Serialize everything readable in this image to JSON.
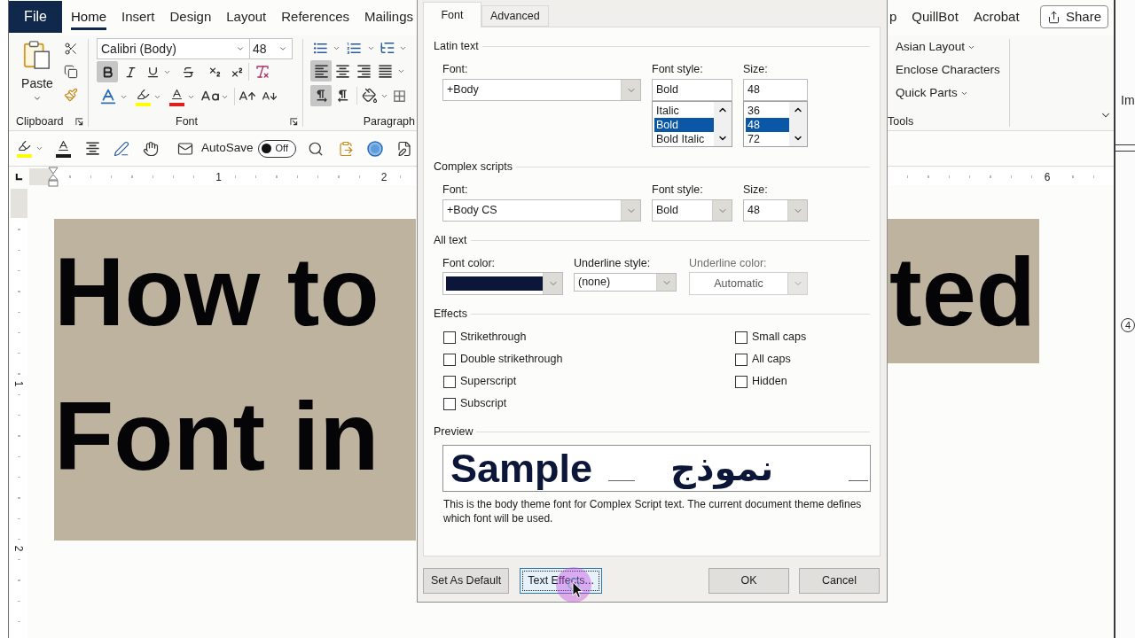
{
  "word": {
    "tabs_left": [
      {
        "label": "File",
        "kind": "file",
        "selected": false
      },
      {
        "label": "Home",
        "kind": "tab",
        "selected": true
      },
      {
        "label": "Insert",
        "kind": "tab",
        "selected": false
      },
      {
        "label": "Design",
        "kind": "tab",
        "selected": false
      },
      {
        "label": "Layout",
        "kind": "tab",
        "selected": false
      },
      {
        "label": "References",
        "kind": "tab",
        "selected": false
      },
      {
        "label": "Mailings",
        "kind": "tab",
        "selected": false
      }
    ],
    "tabs_right": [
      {
        "label": "p",
        "kind": "tab",
        "selected": false
      },
      {
        "label": "QuillBot",
        "kind": "tab",
        "selected": false
      },
      {
        "label": "Acrobat",
        "kind": "tab",
        "selected": false
      }
    ],
    "share_button": "Share",
    "clipboard": {
      "paste_label": "Paste",
      "group_label": "Clipboard"
    },
    "font": {
      "font_name": "Calibri (Body)",
      "font_size": "48",
      "format": [
        {
          "kind": "bold",
          "on": true
        },
        {
          "kind": "italic",
          "on": false
        },
        {
          "kind": "underline",
          "on": false
        },
        {
          "kind": "strikethrough",
          "on": false
        },
        {
          "kind": "subscript",
          "on": false
        },
        {
          "kind": "superscript",
          "on": false
        }
      ],
      "group_label": "Font"
    },
    "paragraph": {
      "align": [
        {
          "kind": "left",
          "on": true
        },
        {
          "kind": "center",
          "on": false
        },
        {
          "kind": "right",
          "on": false
        },
        {
          "kind": "justify",
          "on": false
        }
      ],
      "direction": [
        {
          "kind": "ltr",
          "on": true
        },
        {
          "kind": "rtl",
          "on": false
        }
      ],
      "group_label": "Paragraph"
    },
    "tools": {
      "items": [
        {
          "label": "Asian Layout",
          "dropdown": true
        },
        {
          "label": "Enclose Characters",
          "dropdown": false
        },
        {
          "label": "Quick Parts",
          "dropdown": true
        }
      ],
      "group_label": "Tools"
    },
    "quick_access": {
      "autosave_label": "AutoSave",
      "autosave_state": "Off",
      "autosave_on": false
    },
    "ruler": {
      "left_numbers": [
        "1",
        "2"
      ],
      "right_numbers": [
        "6"
      ]
    },
    "vertical_ruler": {
      "numbers": [
        "1",
        "2"
      ]
    },
    "document": {
      "lines": [
        {
          "left": "How to",
          "right": "ted"
        },
        {
          "left": "Font in"
        }
      ]
    }
  },
  "dialog": {
    "tabs": [
      {
        "label": "Font",
        "selected": true
      },
      {
        "label": "Advanced",
        "selected": false
      }
    ],
    "latin": {
      "title": "Latin text",
      "font": {
        "label": "Font:",
        "value": "+Body"
      },
      "style": {
        "label": "Font style:",
        "value": "Bold",
        "options": [
          {
            "label": "Italic",
            "selected": false
          },
          {
            "label": "Bold",
            "selected": true
          },
          {
            "label": "Bold Italic",
            "selected": false
          }
        ]
      },
      "size": {
        "label": "Size:",
        "value": "48",
        "options": [
          {
            "label": "36",
            "selected": false
          },
          {
            "label": "48",
            "selected": true
          },
          {
            "label": "72",
            "selected": false
          }
        ]
      }
    },
    "complex": {
      "title": "Complex scripts",
      "font": {
        "label": "Font:",
        "value": "+Body CS"
      },
      "style": {
        "label": "Font style:",
        "value": "Bold"
      },
      "size": {
        "label": "Size:",
        "value": "48"
      }
    },
    "all_text": {
      "title": "All text",
      "font_color": {
        "label": "Font color:",
        "color": "#0c1638"
      },
      "underline_style": {
        "label": "Underline style:",
        "value": "(none)"
      },
      "underline_color": {
        "label": "Underline color:",
        "value": "Automatic",
        "disabled": true
      }
    },
    "effects": {
      "title": "Effects",
      "left": [
        {
          "label": "Strikethrough",
          "checked": false
        },
        {
          "label": "Double strikethrough",
          "checked": false
        },
        {
          "label": "Superscript",
          "checked": false
        },
        {
          "label": "Subscript",
          "checked": false
        }
      ],
      "right": [
        {
          "label": "Small caps",
          "checked": false
        },
        {
          "label": "All caps",
          "checked": false
        },
        {
          "label": "Hidden",
          "checked": false
        }
      ]
    },
    "preview": {
      "title": "Preview",
      "sample": "Sample",
      "sample_rtl": "نموذج",
      "description": "This is the body theme font for Complex Script text. The current document theme defines which font will be used."
    },
    "footer": {
      "left": [
        {
          "label": "Set As Default",
          "focused": false
        },
        {
          "label": "Text Effects...",
          "focused": true
        }
      ],
      "right": [
        {
          "label": "OK",
          "focused": false
        },
        {
          "label": "Cancel",
          "focused": false
        }
      ]
    }
  },
  "side_window": {
    "text": "Im",
    "badge": "4"
  }
}
